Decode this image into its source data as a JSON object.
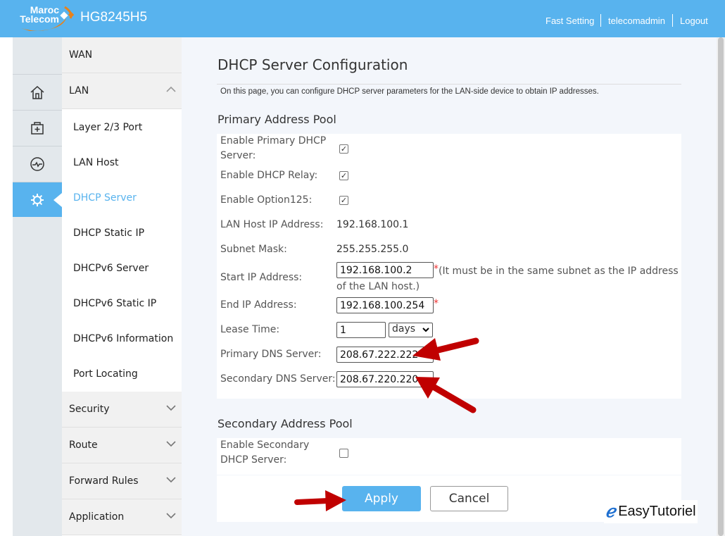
{
  "header": {
    "brand_line1": "Maroc",
    "brand_line2": "Telecom",
    "model": "HG8245H5",
    "links": [
      "Fast Setting",
      "telecomadmin",
      "Logout"
    ]
  },
  "sidebar_icons": [
    "home-icon",
    "toolbox-icon",
    "diagnose-icon",
    "gear-icon"
  ],
  "menu": {
    "wan": "WAN",
    "lan": "LAN",
    "lan_items": [
      "Layer 2/3 Port",
      "LAN Host",
      "DHCP Server",
      "DHCP Static IP",
      "DHCPv6 Server",
      "DHCPv6 Static IP",
      "DHCPv6 Information",
      "Port Locating"
    ],
    "active": "DHCP Server",
    "others": [
      "Security",
      "Route",
      "Forward Rules",
      "Application"
    ]
  },
  "page": {
    "title": "DHCP Server Configuration",
    "description": "On this page, you can configure DHCP server parameters for the LAN-side device to obtain IP addresses.",
    "primary": {
      "heading": "Primary Address Pool",
      "enable_server_label": "Enable Primary DHCP Server:",
      "enable_server": true,
      "enable_relay_label": "Enable DHCP Relay:",
      "enable_relay": true,
      "enable_option125_label": "Enable Option125:",
      "enable_option125": true,
      "lan_host_ip_label": "LAN Host IP Address:",
      "lan_host_ip": "192.168.100.1",
      "subnet_mask_label": "Subnet Mask:",
      "subnet_mask": "255.255.255.0",
      "start_ip_label": "Start IP Address:",
      "start_ip": "192.168.100.2",
      "start_ip_note": "(It must be in the same subnet as the IP address of the LAN host.)",
      "end_ip_label": "End IP Address:",
      "end_ip": "192.168.100.254",
      "required_mark": "*",
      "lease_label": "Lease Time:",
      "lease_value": "1",
      "lease_unit": "days",
      "primary_dns_label": "Primary DNS Server:",
      "primary_dns": "208.67.222.222",
      "secondary_dns_label": "Secondary DNS Server:",
      "secondary_dns": "208.67.220.220"
    },
    "secondary": {
      "heading": "Secondary Address Pool",
      "enable_label": "Enable Secondary DHCP Server:",
      "enable": false
    },
    "apply": "Apply",
    "cancel": "Cancel"
  },
  "watermark": "EasyTutoriel",
  "colors": {
    "header": "#58b3ee",
    "active": "#58b3ee",
    "arrow": "#c00000"
  }
}
